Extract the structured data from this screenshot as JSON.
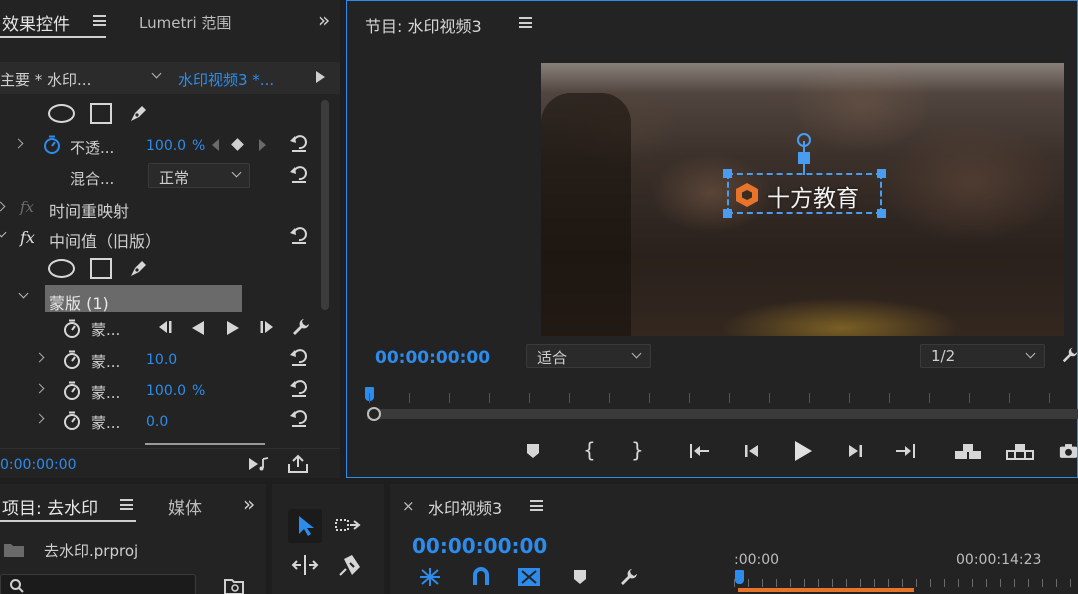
{
  "effects_panel": {
    "tab_effects": "效果控件",
    "tab_lumetri": "Lumetri 范围",
    "expand": "»",
    "source_label": "主要 * 水印...",
    "clip_label": "水印视频3 *...",
    "opacity_label": "不透...",
    "opacity_value": "100.0",
    "opacity_unit": "%",
    "blend_label": "混合...",
    "blend_value": "正常",
    "time_remap": "时间重映射",
    "fx": "fx",
    "median_label": "中间值（旧版）",
    "mask_label": "蒙版 (1)",
    "mask_path_label": "蒙...",
    "mask_feather_label": "蒙...",
    "mask_feather_value": "10.0",
    "mask_opacity_label": "蒙...",
    "mask_opacity_value": "100.0",
    "mask_opacity_unit": "%",
    "mask_expansion_label": "蒙...",
    "mask_expansion_value": "0.0",
    "timecode": "0:00:00:00"
  },
  "program_monitor": {
    "title": "节目: 水印视频3",
    "watermark_text": "十方教育",
    "timecode": "00:00:00:00",
    "fit_value": "适合",
    "resolution_value": "1/2"
  },
  "project_panel": {
    "tab_project": "项目: 去水印",
    "tab_media": "媒体",
    "expand": "»",
    "file_name": "去水印.prproj"
  },
  "timeline": {
    "close": "×",
    "title": "水印视频3",
    "timecode": "00:00:00:00",
    "ruler_start": ":00:00",
    "ruler_mark": "00:00:14:23"
  },
  "colors": {
    "accent": "#2d8ceb",
    "panel_bg": "#232323",
    "app_bg": "#1e1e1e",
    "watermark_logo": "#e8742b"
  }
}
